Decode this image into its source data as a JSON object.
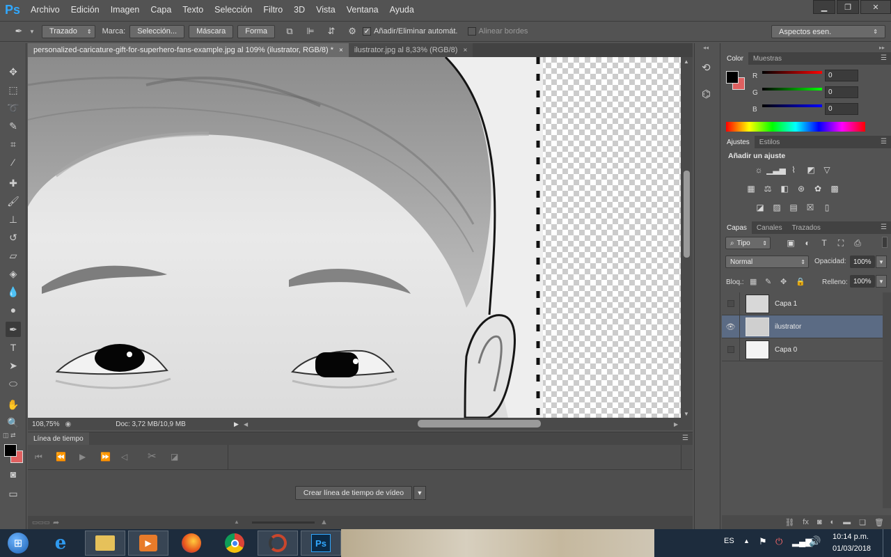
{
  "menubar": {
    "logo": "Ps",
    "items": [
      "Archivo",
      "Edición",
      "Imagen",
      "Capa",
      "Texto",
      "Selección",
      "Filtro",
      "3D",
      "Vista",
      "Ventana",
      "Ayuda"
    ]
  },
  "options": {
    "mode": "Trazado",
    "marca_label": "Marca:",
    "seleccion": "Selección...",
    "mascara": "Máscara",
    "forma": "Forma",
    "auto_add_delete": "Añadir/Eliminar automát.",
    "align_edges": "Alinear bordes",
    "workspace": "Aspectos esen."
  },
  "tabs": [
    {
      "label": "personalized-caricature-gift-for-superhero-fans-example.jpg al 109% (ilustrator, RGB/8) *",
      "close": "×"
    },
    {
      "label": "ilustrator.jpg al 8,33% (RGB/8)",
      "close": "×"
    }
  ],
  "status": {
    "zoom": "108,75%",
    "doc": "Doc: 3,72 MB/10,9 MB"
  },
  "timeline": {
    "title": "Línea de tiempo",
    "create_button": "Crear línea de tiempo de vídeo"
  },
  "color_panel": {
    "tabs": [
      "Color",
      "Muestras"
    ],
    "channels": [
      {
        "label": "R",
        "value": "0",
        "color": "#e01010"
      },
      {
        "label": "G",
        "value": "0",
        "color": "#10c010"
      },
      {
        "label": "B",
        "value": "0",
        "color": "#1010e0"
      }
    ],
    "foreground": "#000000",
    "background": "#e06060"
  },
  "adjust_panel": {
    "tabs": [
      "Ajustes",
      "Estilos"
    ],
    "title": "Añadir un ajuste"
  },
  "layers_panel": {
    "tabs": [
      "Capas",
      "Canales",
      "Trazados"
    ],
    "filter": "Tipo",
    "blend_mode": "Normal",
    "opacity_label": "Opacidad:",
    "opacity": "100%",
    "lock_label": "Bloq.:",
    "fill_label": "Relleno:",
    "fill": "100%",
    "layers": [
      {
        "name": "Capa 1",
        "visible": false,
        "selected": false
      },
      {
        "name": "ilustrator",
        "visible": true,
        "selected": true
      },
      {
        "name": "Capa 0",
        "visible": false,
        "selected": false
      }
    ]
  },
  "taskbar": {
    "language": "ES",
    "time": "10:14 p.m.",
    "date": "01/03/2018"
  }
}
